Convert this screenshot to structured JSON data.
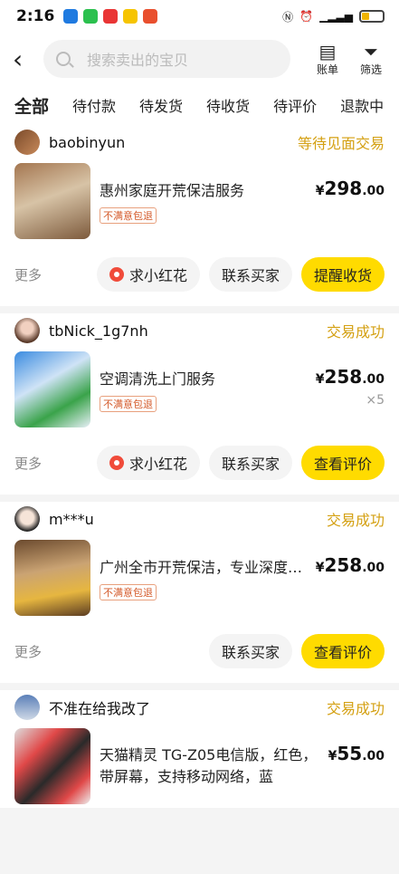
{
  "status": {
    "time": "2:16"
  },
  "header": {
    "search_placeholder": "搜索卖出的宝贝",
    "bill_label": "账单",
    "filter_label": "筛选"
  },
  "tabs": [
    "全部",
    "待付款",
    "待发货",
    "待收货",
    "待评价",
    "退款中"
  ],
  "common": {
    "more": "更多",
    "flower": "求小红花",
    "contact": "联系买家",
    "tag": "不满意包退"
  },
  "orders": [
    {
      "user": "baobinyun",
      "state": "等待见面交易",
      "title": "惠州家庭开荒保洁服务",
      "price_int": "298",
      "price_dec": ".00",
      "qty": "",
      "primary": "提醒收货"
    },
    {
      "user": "tbNick_1g7nh",
      "state": "交易成功",
      "title": "空调清洗上门服务",
      "price_int": "258",
      "price_dec": ".00",
      "qty": "×5",
      "primary": "查看评价"
    },
    {
      "user": "m***u",
      "state": "交易成功",
      "title": "广州全市开荒保洁，专业深度…",
      "price_int": "258",
      "price_dec": ".00",
      "qty": "",
      "primary": "查看评价"
    },
    {
      "user": "不准在给我改了",
      "state": "交易成功",
      "title": "天猫精灵 TG-Z05电信版，红色，带屏幕，支持移动网络，蓝",
      "price_int": "55",
      "price_dec": ".00",
      "qty": "",
      "primary": ""
    }
  ],
  "currency": "¥"
}
